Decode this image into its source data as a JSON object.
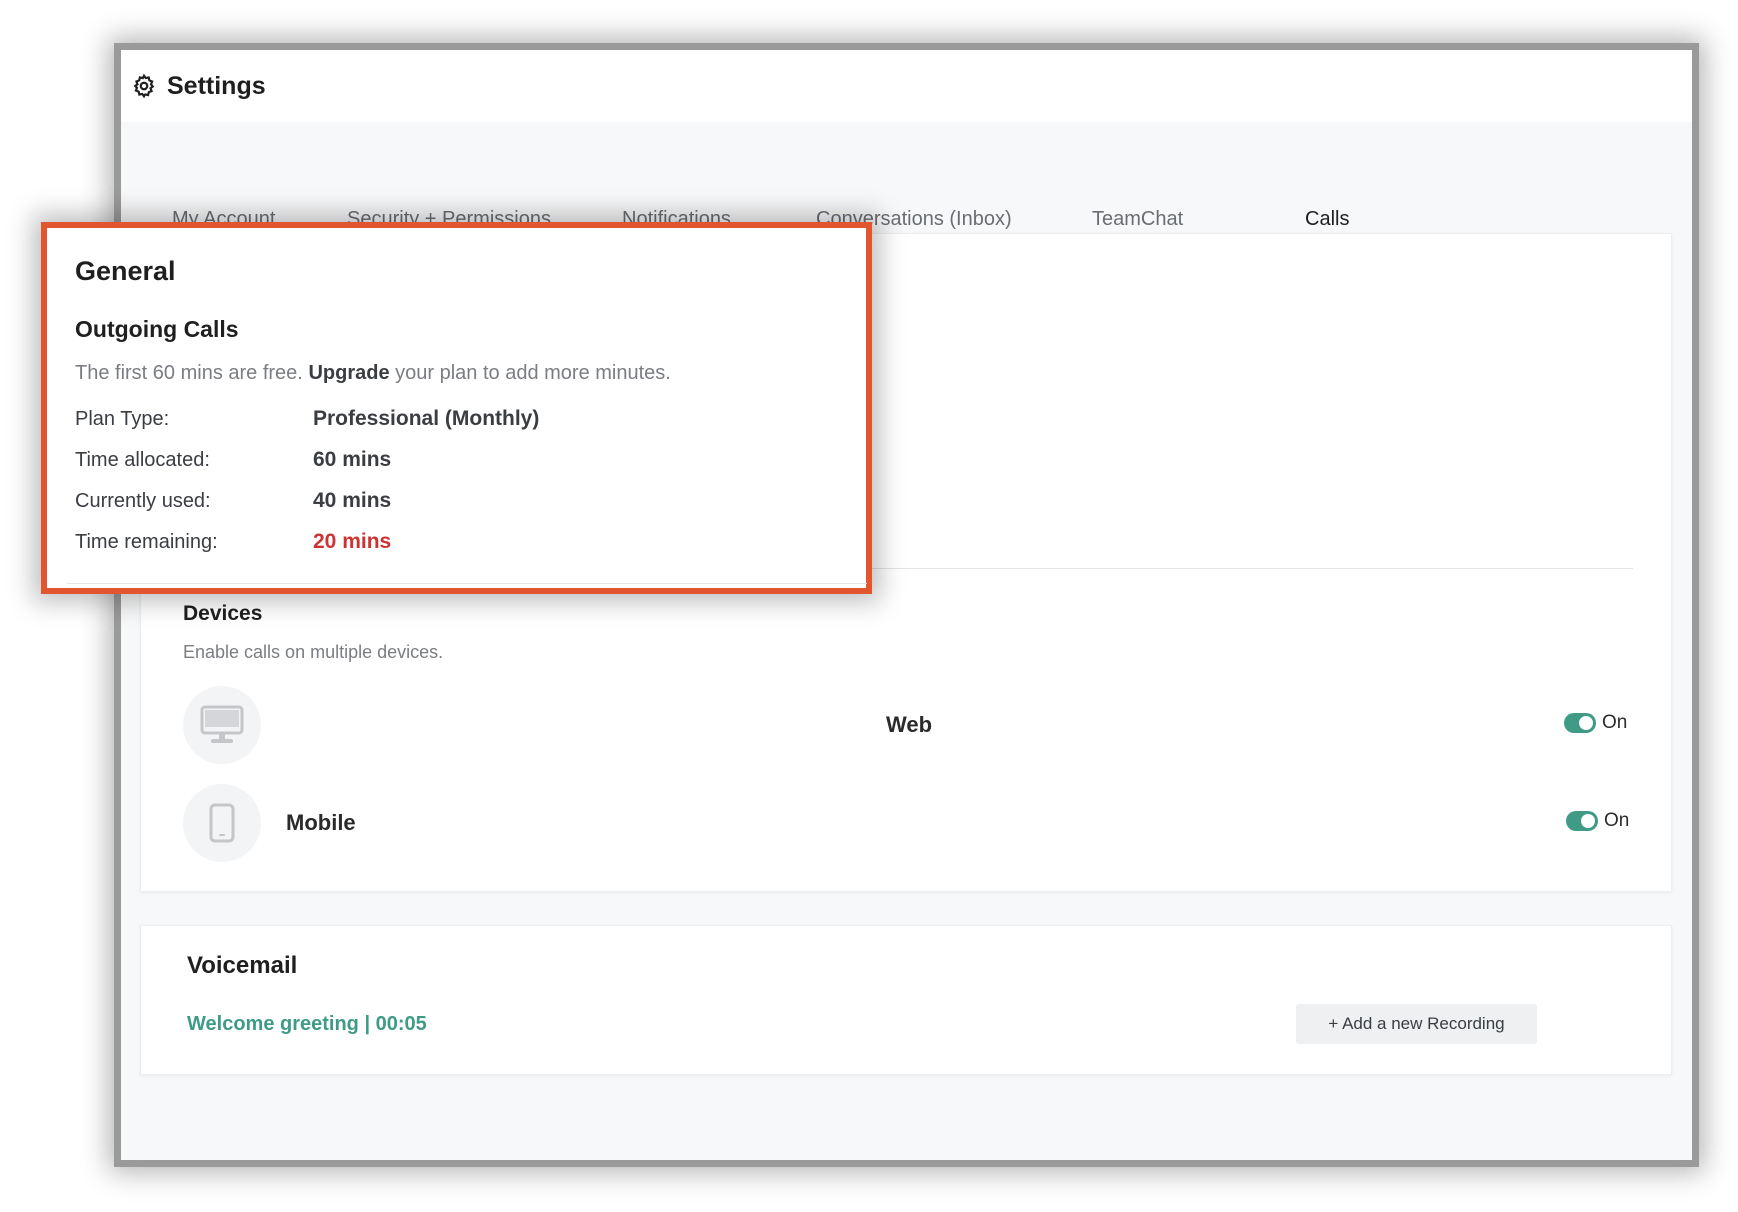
{
  "header": {
    "title": "Settings",
    "icon": "gear-icon"
  },
  "tabs": [
    {
      "label": "My Account",
      "active": false
    },
    {
      "label": "Security + Permissions",
      "active": false
    },
    {
      "label": "Notifications",
      "active": false
    },
    {
      "label": "Conversations (Inbox)",
      "active": false
    },
    {
      "label": "TeamChat",
      "active": false
    },
    {
      "label": "Calls",
      "active": true
    }
  ],
  "general": {
    "title": "General",
    "outgoing_title": "Outgoing Calls",
    "desc_prefix": "The first 60 mins are free.",
    "desc_bold": "Upgrade",
    "desc_suffix": "your plan to add more minutes.",
    "rows": [
      {
        "label": "Plan Type:",
        "value": "Professional (Monthly)"
      },
      {
        "label": "Time allocated:",
        "value": "60 mins"
      },
      {
        "label": "Currently used:",
        "value": "40 mins"
      },
      {
        "label": "Time remaining:",
        "value": "20 mins"
      }
    ]
  },
  "devices": {
    "title": "Devices",
    "description": "Enable calls on multiple devices.",
    "items": [
      {
        "label": "Web",
        "icon": "monitor-icon",
        "toggle": "On"
      },
      {
        "label": "Mobile",
        "icon": "phone-icon",
        "toggle": "On"
      }
    ]
  },
  "voicemail": {
    "title": "Voicemail",
    "greeting": "Welcome greeting  |  00:05",
    "add_button": "+ Add a new Recording"
  },
  "colors": {
    "accent": "#e6603c",
    "toggle_on": "#3f9b86",
    "remaining": "#cc3333",
    "callout_border": "#e2562f"
  }
}
